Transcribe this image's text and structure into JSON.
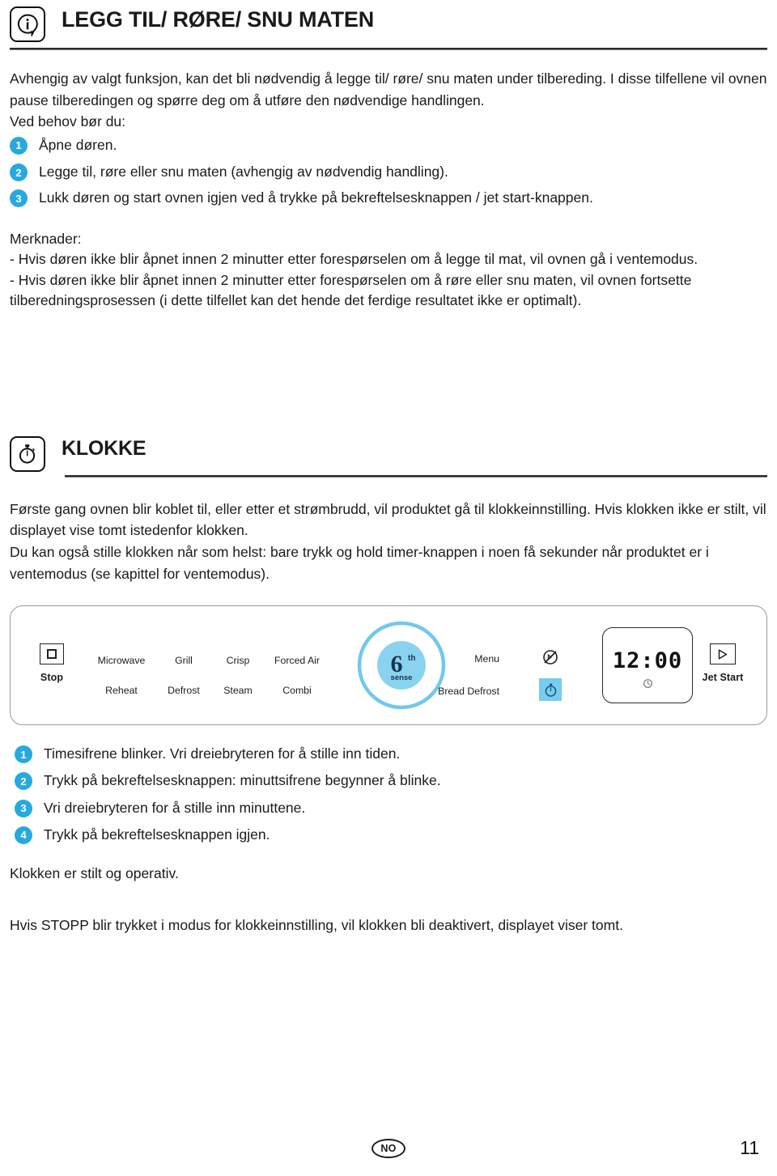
{
  "section1": {
    "icon": "info-icon",
    "title": "LEGG TIL/ RØRE/ SNU MATEN",
    "intro": "Avhengig av valgt funksjon, kan det bli nødvendig å legge til/ røre/ snu maten under tilbereding. I disse tilfellene vil ovnen pause tilberedingen og spørre deg om å utføre den nødvendige handlingen.",
    "lead": "Ved behov bør du:",
    "steps": [
      {
        "num": "1",
        "text": "Åpne døren."
      },
      {
        "num": "2",
        "text": "Legge til, røre eller snu maten (avhengig av nødvendig handling)."
      },
      {
        "num": "3",
        "text": "Lukk døren og start ovnen igjen ved å trykke på bekreftelsesknappen / jet start-knappen."
      }
    ],
    "notes_title": "Merknader:",
    "notes": [
      "- Hvis døren ikke blir åpnet innen 2 minutter etter forespørselen om å legge til mat, vil ovnen gå i ventemodus.",
      "- Hvis døren ikke blir åpnet innen 2 minutter etter forespørselen om å røre eller snu maten, vil ovnen fortsette tilberedningsprosessen (i dette tilfellet kan det hende det ferdige resultatet ikke er optimalt)."
    ]
  },
  "section2": {
    "icon": "stopwatch-icon",
    "title": "KLOKKE",
    "para1": "Første gang ovnen blir koblet til, eller etter et strømbrudd, vil produktet gå til klokkeinnstilling. Hvis klokken ikke er stilt, vil displayet vise tomt istedenfor klokken.",
    "para2": "Du kan også stille klokken når som helst: bare trykk og hold timer-knappen i noen få sekunder når produktet er i ventemodus (se kapittel for ventemodus).",
    "steps": [
      {
        "num": "1",
        "text": "Timesifrene blinker. Vri dreiebryteren for å stille inn tiden."
      },
      {
        "num": "2",
        "text": "Trykk på bekreftelsesknappen: minuttsifrene begynner å blinke."
      },
      {
        "num": "3",
        "text": "Vri dreiebryteren for å stille inn minuttene."
      },
      {
        "num": "4",
        "text": "Trykk på bekreftelsesknappen igjen."
      }
    ],
    "closing1": "Klokken er stilt og operativ.",
    "closing2": "Hvis STOPP blir trykket i modus for klokkeinnstilling, vil klokken bli deaktivert, displayet viser tomt."
  },
  "panel": {
    "stop_label": "Stop",
    "stop_icon": "square-stop-icon",
    "functions_row1": [
      "Microwave",
      "Grill",
      "Crisp",
      "Forced Air"
    ],
    "functions_row2": [
      "Reheat",
      "Defrost",
      "Steam",
      "Combi"
    ],
    "knob": {
      "icon": "sixth-sense-dial",
      "logo_number": "6",
      "logo_sup": "th",
      "logo_word": "sense"
    },
    "menu_label": "Menu",
    "bread_defrost_label": "Bread Defrost",
    "mute_icon": "sound-off-icon",
    "timer_icon": "timer-icon",
    "display_time": "12:00",
    "display_clock_icon": "clock-icon",
    "jet_start_label": "Jet Start",
    "jet_start_icon": "play-triangle-icon",
    "accent_color": "#77cdf0",
    "knob_color": "#72c8ec"
  },
  "footer": {
    "locale_badge": "NO",
    "page_number": "11"
  }
}
